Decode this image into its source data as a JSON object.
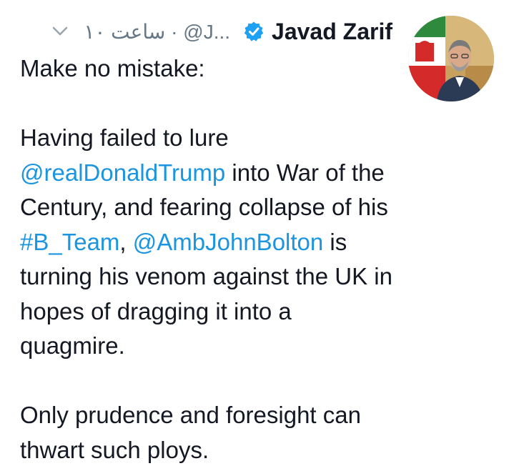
{
  "author": {
    "name": "Javad Zarif",
    "handle": "@J...",
    "time_ago": "۱۰ ساعت",
    "time_separator": "·",
    "verified": true,
    "verified_icon": "verified-badge-icon",
    "menu_icon": "chevron-down-icon"
  },
  "tweet": {
    "line1": "Make no mistake:",
    "p2_a": "Having failed to lure ",
    "p2_mention1": "@realDonaldTrump",
    "p2_b": " into War of the Century, and fearing collapse of his ",
    "p2_hashtag": "#B_Team",
    "p2_c": ", ",
    "p2_mention2": "@AmbJohnBolton",
    "p2_d": " is turning his venom against the UK in hopes of dragging it into a quagmire.",
    "p3": "Only prudence and foresight can thwart such ploys."
  },
  "colors": {
    "link": "#1b95e0",
    "text": "#141823",
    "meta": "#657786",
    "verified": "#1da1f2"
  }
}
